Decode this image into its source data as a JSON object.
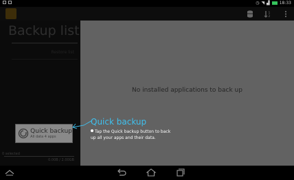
{
  "statusbar": {
    "time": "18:33"
  },
  "sidebar": {
    "title": "Backup list",
    "restore_label": "Restore list",
    "quick_backup": {
      "label": "Quick backup",
      "sub": "All data 4 apps"
    },
    "selected_count": "0 selected",
    "size": "0.00B / 2.00GB"
  },
  "main": {
    "empty_message": "No installed applications to back up"
  },
  "tip": {
    "title": "Quick backup",
    "body": "Tap the Quick backup button to back up all your apps and their data."
  },
  "colors": {
    "accent": "#3fc0ee",
    "battery": "#35c35c",
    "app_icon": "#7a5a12"
  }
}
